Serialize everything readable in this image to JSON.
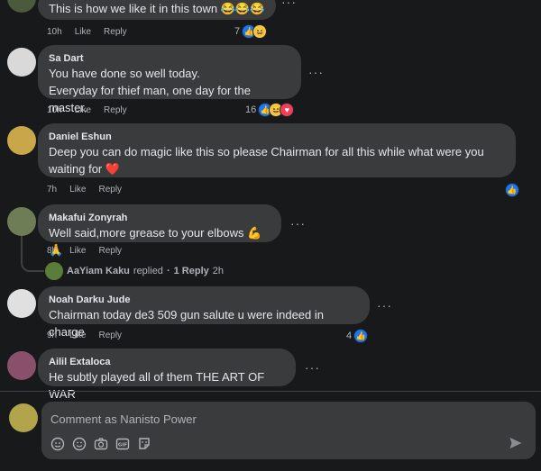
{
  "comments": [
    {
      "name": "",
      "text": "This is how we like it in this town 😂😂😂",
      "time": "10h",
      "like": "Like",
      "reply": "Reply",
      "reaction_count": "7",
      "reactions": [
        "like",
        "haha"
      ]
    },
    {
      "name": "Sa Dart",
      "text": "You have done so well today.\nEveryday for thief man, one day for the master.",
      "time": "10h",
      "like": "Like",
      "reply": "Reply",
      "reaction_count": "16",
      "reactions": [
        "like",
        "haha",
        "love"
      ]
    },
    {
      "name": "Daniel Eshun",
      "text": "Deep you can do magic like this so please Chairman for all this while what were you\nwaiting for ❤️",
      "time": "7h",
      "like": "Like",
      "reply": "Reply",
      "reaction_count": "",
      "reactions": [
        "like"
      ]
    },
    {
      "name": "Makafui Zonyrah",
      "text": "Well said,more grease to your elbows 💪🙏",
      "time": "8h",
      "like": "Like",
      "reply": "Reply",
      "reaction_count": "",
      "reactions": []
    },
    {
      "name": "Noah Darku Jude",
      "text": "Chairman today de3 509 gun salute u were indeed in charge",
      "time": "9h",
      "like": "Like",
      "reply": "Reply",
      "reaction_count": "4",
      "reactions": [
        "like"
      ]
    },
    {
      "name": "Ailil Extaloca",
      "text": "He subtly played all of them THE ART OF WAR",
      "time": "",
      "like": "",
      "reply": "",
      "reaction_count": "",
      "reactions": []
    }
  ],
  "reply_thread": {
    "user": "AaYiam Kaku",
    "action": "replied",
    "separator": "·",
    "count_label": "1 Reply",
    "time": "2h"
  },
  "composer": {
    "placeholder": "Comment as Nanisto Power",
    "tools": [
      "sticker-icon",
      "emoji-icon",
      "camera-icon",
      "gif-icon",
      "avatar-sticker-icon"
    ],
    "send_icon": "send-icon"
  },
  "colors": {
    "background": "#18191a",
    "bubble": "#3a3b3c",
    "like_blue": "#1877f2"
  }
}
